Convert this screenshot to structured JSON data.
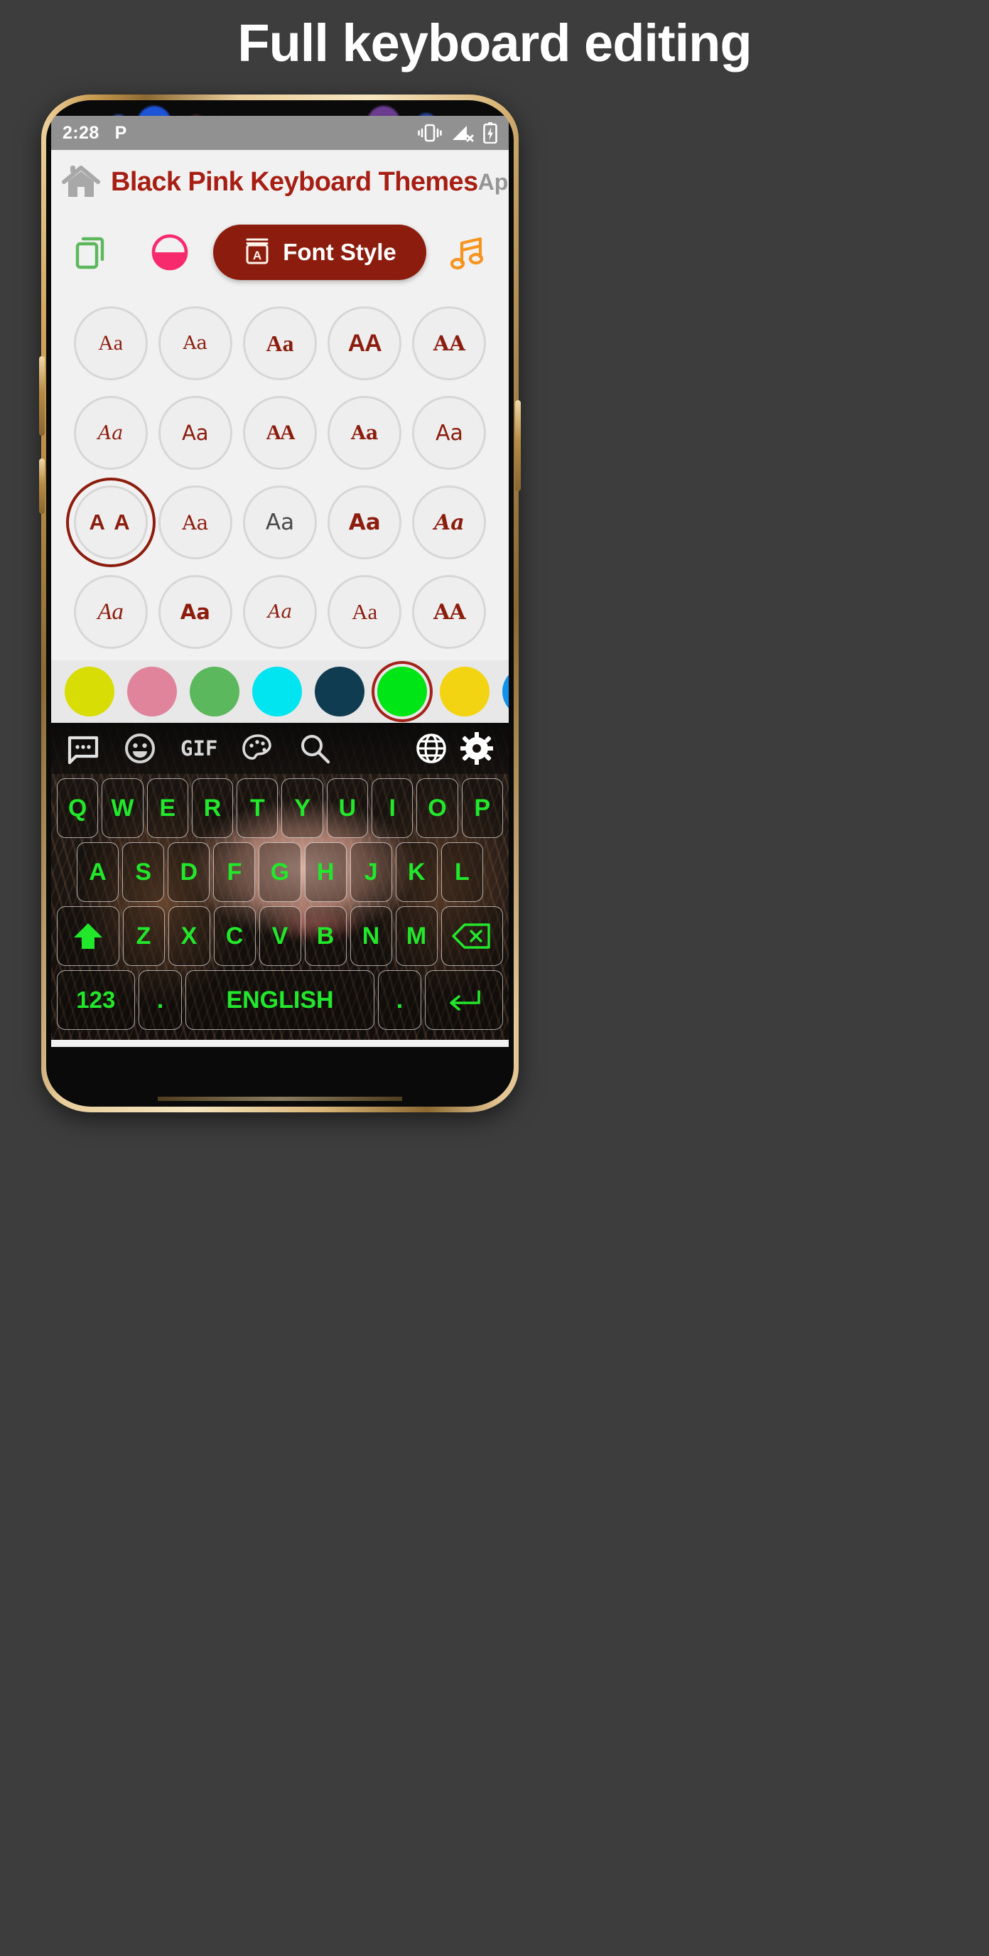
{
  "promo": {
    "headline": "Full keyboard editing"
  },
  "status_bar": {
    "time": "2:28",
    "carrier_glyph": "P",
    "icons": [
      "vibrate-icon",
      "signal-no-service-icon",
      "battery-charging-icon"
    ]
  },
  "app_header": {
    "home_icon": "home-icon",
    "title": "Black Pink Keyboard Themes",
    "apply_label": "Apply"
  },
  "toolbar": {
    "theme_icon": "copy-theme-icon",
    "theme_icon_color": "#5cb85c",
    "brightness_icon": "half-circle-brightness-icon",
    "brightness_icon_color": "#f72a6e",
    "font_style_button": {
      "label": "Font Style",
      "icon": "book-letter-a-icon",
      "background": "#8c1d0e",
      "text_color": "#ffffff"
    },
    "music_icon": "music-note-icon",
    "music_icon_color": "#f7941e"
  },
  "font_grid": {
    "selected_index": 10,
    "accent": "#8c1d0e",
    "items": [
      {
        "sample": "Aa",
        "style": "f-s1"
      },
      {
        "sample": "Aa",
        "style": "f-s2"
      },
      {
        "sample": "Aa",
        "style": "f-s3"
      },
      {
        "sample": "AA",
        "style": "f-s4"
      },
      {
        "sample": "AA",
        "style": "f-s5"
      },
      {
        "sample": "Aa",
        "style": "f-s6"
      },
      {
        "sample": "Aa",
        "style": "f-s7"
      },
      {
        "sample": "AA",
        "style": "f-s8"
      },
      {
        "sample": "Aa",
        "style": "f-s9"
      },
      {
        "sample": "Aa",
        "style": "f-s10"
      },
      {
        "sample": "A A",
        "style": "f-s11"
      },
      {
        "sample": "Aa",
        "style": "f-s12"
      },
      {
        "sample": "Aa",
        "style": "f-s13"
      },
      {
        "sample": "Aa",
        "style": "f-s14"
      },
      {
        "sample": "Aa",
        "style": "f-s15"
      },
      {
        "sample": "Aa",
        "style": "f-s16"
      },
      {
        "sample": "Aa",
        "style": "f-s17"
      },
      {
        "sample": "Aa",
        "style": "f-s18"
      },
      {
        "sample": "Aa",
        "style": "f-s19"
      },
      {
        "sample": "AA",
        "style": "f-s20"
      }
    ]
  },
  "color_strip": {
    "selected_index": 5,
    "selection_ring": "#a3221b",
    "colors": [
      {
        "name": "yellow-green",
        "hex": "#d8dd06"
      },
      {
        "name": "pink",
        "hex": "#e0849c"
      },
      {
        "name": "green",
        "hex": "#5cb85c"
      },
      {
        "name": "cyan",
        "hex": "#00e5f0"
      },
      {
        "name": "dark-navy",
        "hex": "#103c52"
      },
      {
        "name": "bright-green",
        "hex": "#00e515"
      },
      {
        "name": "yellow",
        "hex": "#f2d413"
      },
      {
        "name": "blue",
        "hex": "#1293e8"
      }
    ]
  },
  "keyboard": {
    "toolbar_icons": [
      "chat-bubble-icon",
      "smiley-icon",
      "gif-label",
      "palette-icon",
      "search-icon",
      "globe-icon",
      "gear-icon"
    ],
    "gif_label": "GIF",
    "key_color": "#22e82b",
    "rows": [
      {
        "keys": [
          "Q",
          "W",
          "E",
          "R",
          "T",
          "Y",
          "U",
          "I",
          "O",
          "P"
        ]
      },
      {
        "keys": [
          "A",
          "S",
          "D",
          "F",
          "G",
          "H",
          "J",
          "K",
          "L"
        ]
      },
      {
        "keys": [
          "shift-icon",
          "Z",
          "X",
          "C",
          "V",
          "B",
          "N",
          "M",
          "backspace-icon"
        ]
      },
      {
        "keys": [
          "123",
          ".",
          "ENGLISH",
          ".",
          "enter-icon"
        ]
      }
    ],
    "numeric_key_label": "123",
    "language_key_label": "ENGLISH",
    "period_key_label": "."
  }
}
